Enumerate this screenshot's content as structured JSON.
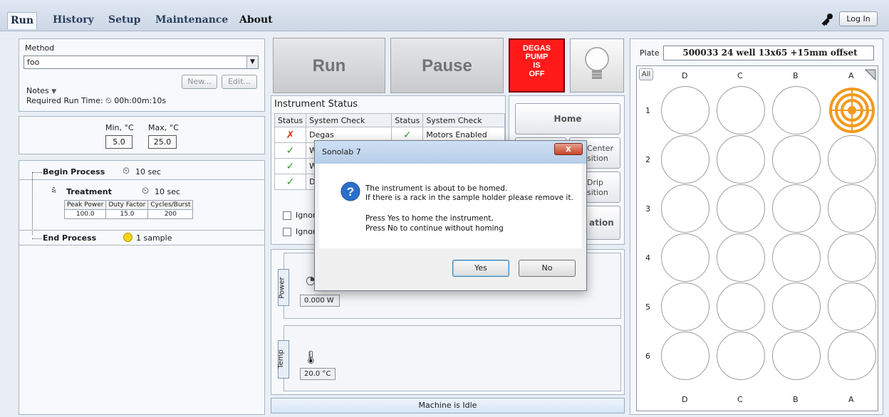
{
  "menu": {
    "items": [
      "Run",
      "History",
      "Setup",
      "Maintenance",
      "About"
    ],
    "login": "Log In"
  },
  "method": {
    "label": "Method",
    "value": "foo",
    "new_btn": "New...",
    "edit_btn": "Edit...",
    "notes_label": "Notes",
    "runtime_label": "Required Run Time:",
    "runtime_value": "00h:00m:10s"
  },
  "temperature": {
    "min_label": "Min, °C",
    "max_label": "Max, °C",
    "min_value": "5.0",
    "max_value": "25.0"
  },
  "process": {
    "begin": {
      "label": "Begin Process",
      "time": "10 sec"
    },
    "treatment": {
      "label": "Treatment",
      "time": "10 sec",
      "headers": [
        "Peak Power",
        "Duty Factor",
        "Cycles/Burst"
      ],
      "values": [
        "100.0",
        "15.0",
        "200"
      ]
    },
    "end": {
      "label": "End Process",
      "samples": "1 sample"
    }
  },
  "controls": {
    "run": "Run",
    "pause": "Pause",
    "degas_lines": [
      "DEGAS",
      "PUMP",
      "IS",
      "OFF"
    ]
  },
  "instrument_status": {
    "title": "Instrument Status",
    "headers": [
      "Status",
      "System Check",
      "Status",
      "System Check"
    ],
    "rows": [
      {
        "s1": "✗",
        "c1": "Degas",
        "s2": "✓",
        "c2": "Motors Enabled"
      },
      {
        "s1": "✓",
        "c1": "Wa",
        "s2": "✓",
        "c2": ""
      },
      {
        "s1": "✓",
        "c1": "Wa",
        "s2": "",
        "c2": ""
      },
      {
        "s1": "✓",
        "c1": "Do",
        "s2": "",
        "c2": ""
      }
    ],
    "ignore_1": "Ignor",
    "ignore_2": "Ignor"
  },
  "commands": {
    "home": "Home",
    "center_1": "Center",
    "center_2": "sition",
    "drip_1": "Drip",
    "drip_2": "sition",
    "other": "ation"
  },
  "power": {
    "tab": "Power",
    "value": "0.000 W"
  },
  "temp": {
    "tab": "Temp",
    "value": "20.0 °C"
  },
  "status_bar": "Machine is Idle",
  "plate": {
    "label": "Plate",
    "name": "500033 24 well 13x65 +15mm offset",
    "all_btn": "All",
    "columns": [
      "D",
      "C",
      "B",
      "A"
    ],
    "rows": [
      "1",
      "2",
      "3",
      "4",
      "5",
      "6"
    ],
    "target_well": "A1"
  },
  "dialog": {
    "title": "Sonolab 7",
    "close": "x",
    "line1": "The instrument is about to be homed.",
    "line2": "If there is a rack in the sample holder please remove it.",
    "line3": "Press Yes to home the instrument,",
    "line4": "Press No to continue without homing",
    "yes": "Yes",
    "no": "No"
  },
  "colors": {
    "degas_bg": "#ff1a1a",
    "target": "#f39a1e",
    "check": "#2e9d2e",
    "cross": "#d42a12"
  }
}
